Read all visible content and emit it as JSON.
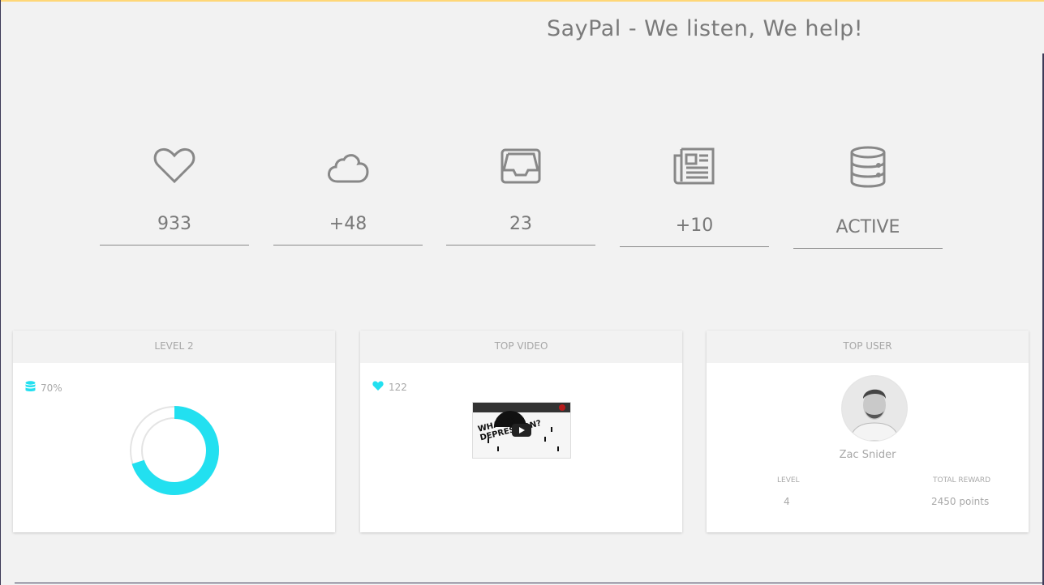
{
  "header": {
    "title": "SayPal - We listen, We help!"
  },
  "stats": [
    {
      "icon": "heart-icon",
      "value": "933"
    },
    {
      "icon": "cloud-icon",
      "value": "+48"
    },
    {
      "icon": "inbox-icon",
      "value": "23"
    },
    {
      "icon": "newspaper-icon",
      "value": "+10"
    },
    {
      "icon": "database-icon",
      "value": "ACTIVE"
    }
  ],
  "level_panel": {
    "title": "LEVEL 2",
    "percent_label": "70%",
    "progress": 0.7,
    "accent": "#22e0f0"
  },
  "video_panel": {
    "title": "TOP VIDEO",
    "likes": "122",
    "thumbnail_text": "WHAT IS DEPRESSION?"
  },
  "user_panel": {
    "title": "TOP USER",
    "name": "Zac Snider",
    "level_label": "LEVEL",
    "level_value": "4",
    "reward_label": "TOTAL REWARD",
    "reward_value": "2450 points"
  }
}
